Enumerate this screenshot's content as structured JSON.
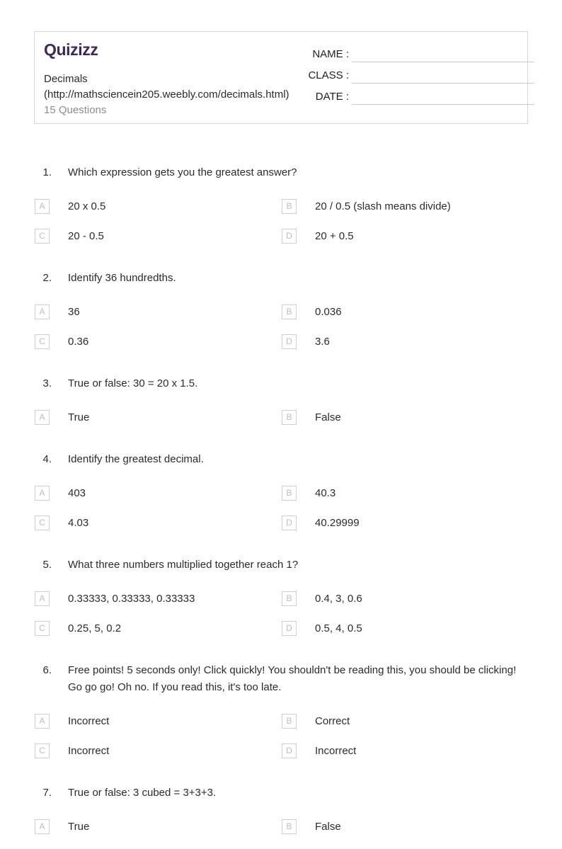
{
  "header": {
    "brand": "Quizizz",
    "brand_color": "#3f2a56",
    "title": "Decimals",
    "url": "(http://mathsciencein205.weebly.com/decimals.html)",
    "question_count": "15 Questions",
    "fields": [
      {
        "id": "name",
        "label": "NAME :"
      },
      {
        "id": "class",
        "label": "CLASS :"
      },
      {
        "id": "date",
        "label": "DATE  :"
      }
    ]
  },
  "questions": [
    {
      "number": "1.",
      "text": "Which expression gets you the greatest answer?",
      "lines": 1,
      "options": [
        {
          "letter": "A",
          "text": "20 x 0.5"
        },
        {
          "letter": "B",
          "text": "20 / 0.5 (slash means divide)"
        },
        {
          "letter": "C",
          "text": "20 - 0.5"
        },
        {
          "letter": "D",
          "text": "20 + 0.5"
        }
      ]
    },
    {
      "number": "2.",
      "text": "Identify 36 hundredths.",
      "lines": 1,
      "options": [
        {
          "letter": "A",
          "text": "36"
        },
        {
          "letter": "B",
          "text": "0.036"
        },
        {
          "letter": "C",
          "text": "0.36"
        },
        {
          "letter": "D",
          "text": "3.6"
        }
      ]
    },
    {
      "number": "3.",
      "text": "True or false: 30 = 20 x 1.5.",
      "lines": 1,
      "options": [
        {
          "letter": "A",
          "text": "True"
        },
        {
          "letter": "B",
          "text": "False"
        }
      ]
    },
    {
      "number": "4.",
      "text": "Identify the greatest decimal.",
      "lines": 1,
      "options": [
        {
          "letter": "A",
          "text": "403"
        },
        {
          "letter": "B",
          "text": "40.3"
        },
        {
          "letter": "C",
          "text": "4.03"
        },
        {
          "letter": "D",
          "text": "40.29999"
        }
      ]
    },
    {
      "number": "5.",
      "text": "What three numbers multiplied together reach 1?",
      "lines": 1,
      "options": [
        {
          "letter": "A",
          "text": "0.33333, 0.33333, 0.33333"
        },
        {
          "letter": "B",
          "text": "0.4, 3, 0.6"
        },
        {
          "letter": "C",
          "text": "0.25, 5, 0.2"
        },
        {
          "letter": "D",
          "text": "0.5, 4, 0.5"
        }
      ]
    },
    {
      "number": "6.",
      "text": "Free points! 5 seconds only! Click quickly! You shouldn't be reading this, you should be clicking! Go go go! Oh no. If you read this, it's too late.",
      "lines": 2,
      "options": [
        {
          "letter": "A",
          "text": "Incorrect"
        },
        {
          "letter": "B",
          "text": "Correct"
        },
        {
          "letter": "C",
          "text": "Incorrect"
        },
        {
          "letter": "D",
          "text": "Incorrect"
        }
      ]
    },
    {
      "number": "7.",
      "text": "True or false: 3 cubed = 3+3+3.",
      "lines": 1,
      "options": [
        {
          "letter": "A",
          "text": "True"
        },
        {
          "letter": "B",
          "text": "False"
        }
      ]
    }
  ]
}
